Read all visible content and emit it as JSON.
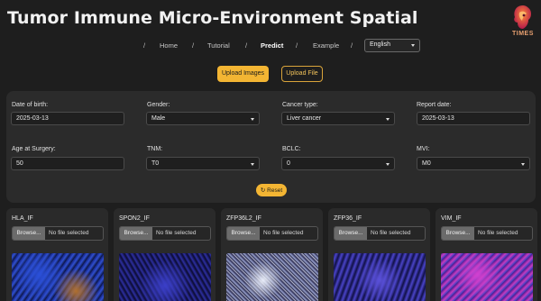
{
  "header": {
    "title": "Tumor Immune Micro-Environment Spatial",
    "logo_text": "TIMES"
  },
  "nav": {
    "separator": "/",
    "items": [
      {
        "label": "Home",
        "active": false
      },
      {
        "label": "Tutorial",
        "active": false
      },
      {
        "label": "Predict",
        "active": true
      },
      {
        "label": "Example",
        "active": false
      }
    ],
    "language": "English"
  },
  "upload_mode": {
    "images_label": "Upload Images",
    "file_label": "Upload File",
    "selected": "images"
  },
  "form": {
    "dob": {
      "label": "Date of birth:",
      "value": "2025-03-13"
    },
    "gender": {
      "label": "Gender:",
      "value": "Male"
    },
    "cancer_type": {
      "label": "Cancer type:",
      "value": "Liver cancer"
    },
    "report_date": {
      "label": "Report date:",
      "value": "2025-03-13"
    },
    "age_at_surgery": {
      "label": "Age at Surgery:",
      "value": "50"
    },
    "tnm": {
      "label": "TNM:",
      "value": "T0"
    },
    "bclc": {
      "label": "BCLC:",
      "value": "0"
    },
    "mvi": {
      "label": "MVI:",
      "value": "M0"
    },
    "reset_label": "Reset"
  },
  "cards": [
    {
      "title": "HLA_IF",
      "browse": "Browse...",
      "file_status": "No file selected",
      "accent": "#3a5fd0"
    },
    {
      "title": "SPON2_IF",
      "browse": "Browse...",
      "file_status": "No file selected",
      "accent": "#3b3fc9"
    },
    {
      "title": "ZFP36L2_IF",
      "browse": "Browse...",
      "file_status": "No file selected",
      "accent": "#c8d0e8"
    },
    {
      "title": "ZFP36_IF",
      "browse": "Browse...",
      "file_status": "No file selected",
      "accent": "#4a44c8"
    },
    {
      "title": "VIM_IF",
      "browse": "Browse...",
      "file_status": "No file selected",
      "accent": "#c53cc0"
    }
  ],
  "colors": {
    "primary": "#f3b533",
    "background": "#1e1e1e",
    "panel": "#2b2b2b"
  }
}
